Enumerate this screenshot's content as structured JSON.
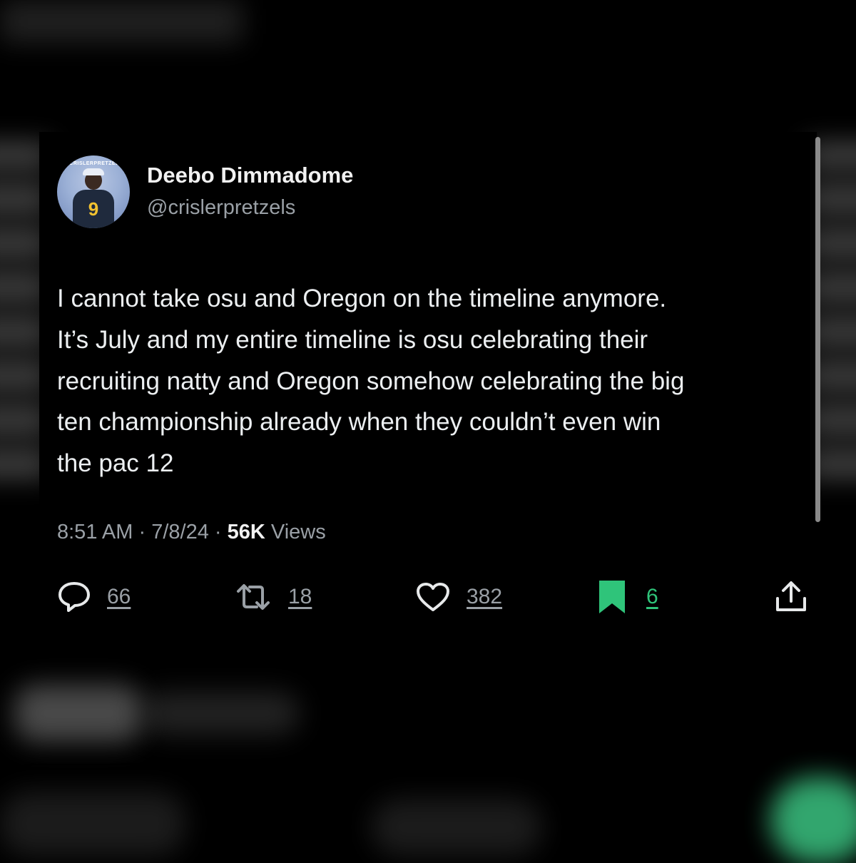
{
  "tweet": {
    "avatar_banner": "@CRISLERPRETZELS",
    "avatar_number": "9",
    "display_name": "Deebo Dimmadome",
    "handle": "@crislerpretzels",
    "text_lines": [
      "I cannot take osu and Oregon on the timeline anymore.",
      "It’s July and my entire timeline is osu celebrating their",
      "recruiting natty and Oregon somehow celebrating the big",
      "ten championship already when they couldn’t even win",
      "the pac 12"
    ],
    "time": "8:51 AM",
    "date": "7/8/24",
    "separator": "·",
    "views_count": "56K",
    "views_label": "Views"
  },
  "actions": {
    "reply": {
      "icon": "reply-icon",
      "count": "66"
    },
    "retweet": {
      "icon": "retweet-icon",
      "count": "18"
    },
    "like": {
      "icon": "heart-icon",
      "count": "382"
    },
    "bookmark": {
      "icon": "bookmark-icon",
      "count": "6",
      "color": "#2fc47a"
    },
    "share": {
      "icon": "share-icon"
    }
  },
  "colors": {
    "background": "#000000",
    "text": "#e7e9ea",
    "secondary": "#9aa0a6",
    "bookmark_active": "#2fc47a"
  }
}
